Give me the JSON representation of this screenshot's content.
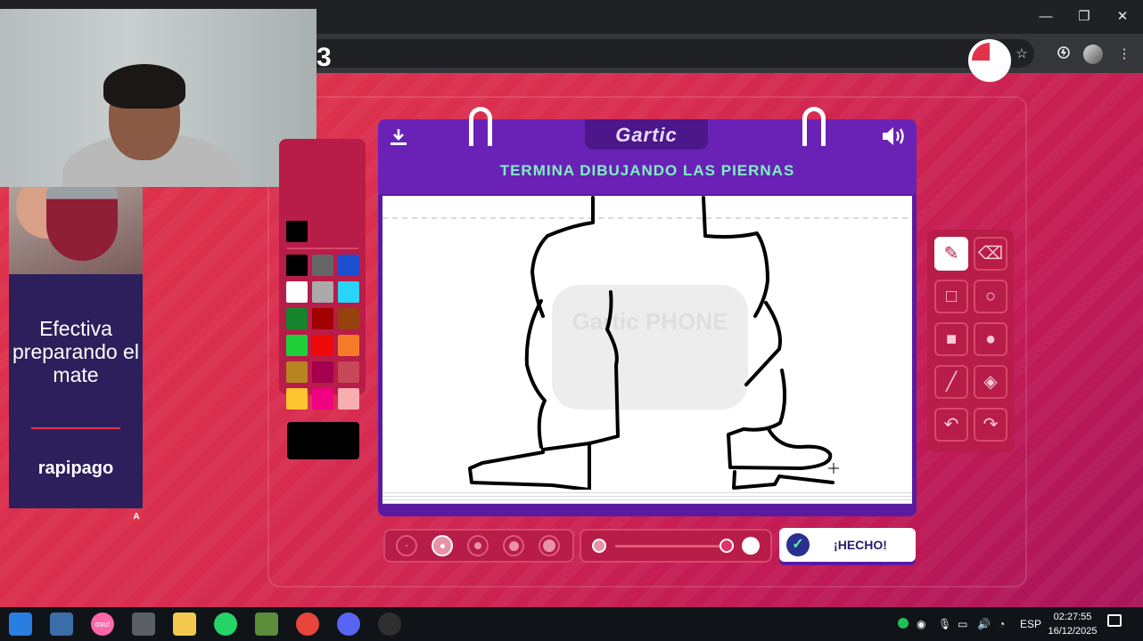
{
  "browser": {
    "window_buttons": {
      "minimize": "—",
      "maximize": "❐",
      "close": "✕"
    },
    "toolbar_icons": [
      "mute-site-icon",
      "star-icon",
      "extensions-icon",
      "profile-avatar",
      "menu-icon"
    ]
  },
  "game": {
    "round_number": "3",
    "logo": "Gartic",
    "prompt": "TERMINA DIBUJANDO LAS PIERNAS",
    "watermark": "Gartic PHONE",
    "timer_fraction_elapsed": 0.25,
    "selected_color": "#000000",
    "palette": [
      [
        "#000000",
        "#666666",
        "#1e4fd0"
      ],
      [
        "#ffffff",
        "#aaaaaa",
        "#2ad4f6"
      ],
      [
        "#14852c",
        "#a30000",
        "#96420f"
      ],
      [
        "#1fd03b",
        "#ee0a0a",
        "#f57b2a"
      ],
      [
        "#b78422",
        "#a4004d",
        "#c74858"
      ],
      [
        "#fec531",
        "#f1007f",
        "#f8aeae"
      ]
    ],
    "tools": [
      "pencil-icon",
      "eraser-icon",
      "square-outline-icon",
      "circle-outline-icon",
      "square-filled-icon",
      "circle-filled-icon",
      "line-icon",
      "fill-bucket-icon",
      "undo-icon",
      "redo-icon"
    ],
    "active_tool": "pencil",
    "brush_sizes": [
      "1",
      "2",
      "3",
      "4",
      "5"
    ],
    "selected_brush_size": "2",
    "done_label": "¡HECHO!"
  },
  "ad": {
    "headline": "Efectiva preparando el mate",
    "brand": "rapipago",
    "badge": "A"
  },
  "taskbar": {
    "apps": [
      "windows-start",
      "calculator",
      "osu",
      "camera",
      "file-explorer",
      "whatsapp",
      "minecraft",
      "chrome",
      "discord",
      "obs"
    ],
    "osu_label": "osu!",
    "language": "ESP",
    "time": "02:27:55",
    "date": "16/12/2025"
  }
}
